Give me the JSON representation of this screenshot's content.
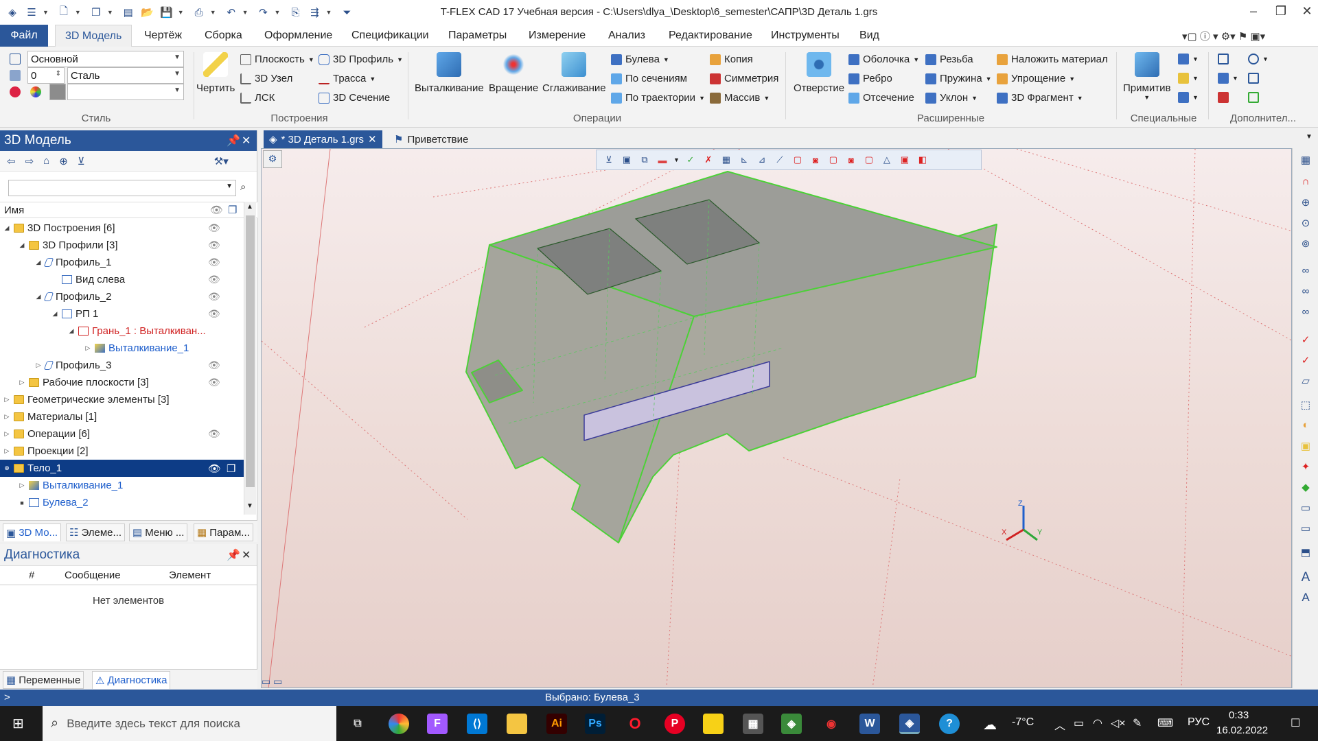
{
  "window": {
    "title": "T-FLEX CAD 17 Учебная версия - C:\\Users\\dlya_\\Desktop\\6_semester\\САПР\\3D Деталь 1.grs"
  },
  "menu": {
    "file": "Файл",
    "tabs": [
      "3D Модель",
      "Чертёж",
      "Сборка",
      "Оформление",
      "Спецификации",
      "Параметры",
      "Измерение",
      "Анализ",
      "Редактирование",
      "Инструменты",
      "Вид"
    ]
  },
  "ribbon": {
    "style": {
      "layer": "Основной",
      "level": "0",
      "material": "Сталь",
      "label": "Стиль"
    },
    "build": {
      "draw": "Чертить",
      "plane": "Плоскость",
      "node3d": "3D Узел",
      "lsk": "ЛСК",
      "profile3d": "3D Профиль",
      "path": "Трасса",
      "section3d": "3D Сечение",
      "label": "Построения"
    },
    "ops": {
      "extrude": "Выталкивание",
      "rotate": "Вращение",
      "smooth": "Сглаживание",
      "boolean": "Булева",
      "bysection": "По сечениям",
      "bytrajectory": "По траектории",
      "copy": "Копия",
      "symmetry": "Симметрия",
      "array": "Массив",
      "label": "Операции"
    },
    "ext": {
      "hole": "Отверстие",
      "shell": "Оболочка",
      "rib": "Ребро",
      "cut": "Отсечение",
      "thread": "Резьба",
      "spring": "Пружина",
      "slope": "Уклон",
      "material": "Наложить материал",
      "simplify": "Упрощение",
      "fragment3d": "3D Фрагмент",
      "label": "Расширенные"
    },
    "special": {
      "primitive": "Примитив",
      "label": "Специальные"
    },
    "extra": {
      "label": "Дополнител..."
    }
  },
  "model_panel": {
    "title": "3D Модель",
    "tree_header": "Имя",
    "tree": [
      {
        "label": "3D Построения [6]"
      },
      {
        "label": "3D Профили [3]"
      },
      {
        "label": "Профиль_1"
      },
      {
        "label": "Вид слева"
      },
      {
        "label": "Профиль_2"
      },
      {
        "label": "РП 1"
      },
      {
        "label": "Грань_1 : Выталкиван..."
      },
      {
        "label": "Выталкивание_1"
      },
      {
        "label": "Профиль_3"
      },
      {
        "label": "Рабочие плоскости [3]"
      },
      {
        "label": "Геометрические элементы [3]"
      },
      {
        "label": "Материалы [1]"
      },
      {
        "label": "Операции [6]"
      },
      {
        "label": "Проекции [2]"
      },
      {
        "label": "Тело_1"
      },
      {
        "label": "Выталкивание_1"
      },
      {
        "label": "Булева_2"
      }
    ],
    "tabs": [
      "3D Мо...",
      "Элеме...",
      "Меню ...",
      "Парам..."
    ]
  },
  "diagnostics": {
    "title": "Диагностика",
    "cols": [
      "#",
      "Сообщение",
      "Элемент"
    ],
    "empty": "Нет элементов",
    "tabs": [
      "Переменные",
      "Диагностика"
    ]
  },
  "doc_tabs": [
    "* 3D Деталь 1.grs",
    "Приветствие"
  ],
  "status": {
    "text": "Выбрано: Булева_3",
    "prompt": ">"
  },
  "taskbar": {
    "search_placeholder": "Введите здесь текст для поиска",
    "weather": "-7°C",
    "lang": "РУС",
    "time": "0:33",
    "date": "16.02.2022"
  },
  "axis": {
    "x": "X",
    "y": "Y",
    "z": "Z"
  },
  "colors": {
    "accent": "#2b579a",
    "selection_edge": "#4cd137",
    "body": "#a8a8a0"
  }
}
